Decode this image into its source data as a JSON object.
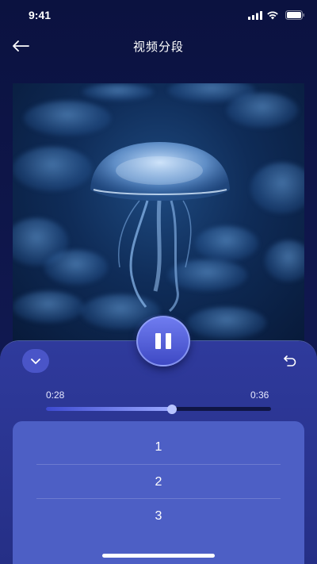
{
  "status_bar": {
    "time": "9:41",
    "icons": [
      "signal-icon",
      "wifi-icon",
      "battery-icon"
    ]
  },
  "header": {
    "title": "视频分段",
    "back_icon": "arrow-left-icon"
  },
  "video": {
    "description_icon": "jellyfish-thumbnail",
    "state": "playing"
  },
  "player": {
    "pause_icon": "pause-icon",
    "collapse_icon": "chevron-down-icon",
    "undo_icon": "undo-icon",
    "time_start": "0:28",
    "time_end": "0:36",
    "progress_fraction": 0.56
  },
  "segments": {
    "items": [
      {
        "label": "1"
      },
      {
        "label": "2"
      },
      {
        "label": "3"
      }
    ]
  },
  "colors": {
    "background": "#0b1240",
    "panel": "#2f3a9c",
    "accent": "#6f7cf0",
    "segment_list": "#4d5fc5"
  }
}
